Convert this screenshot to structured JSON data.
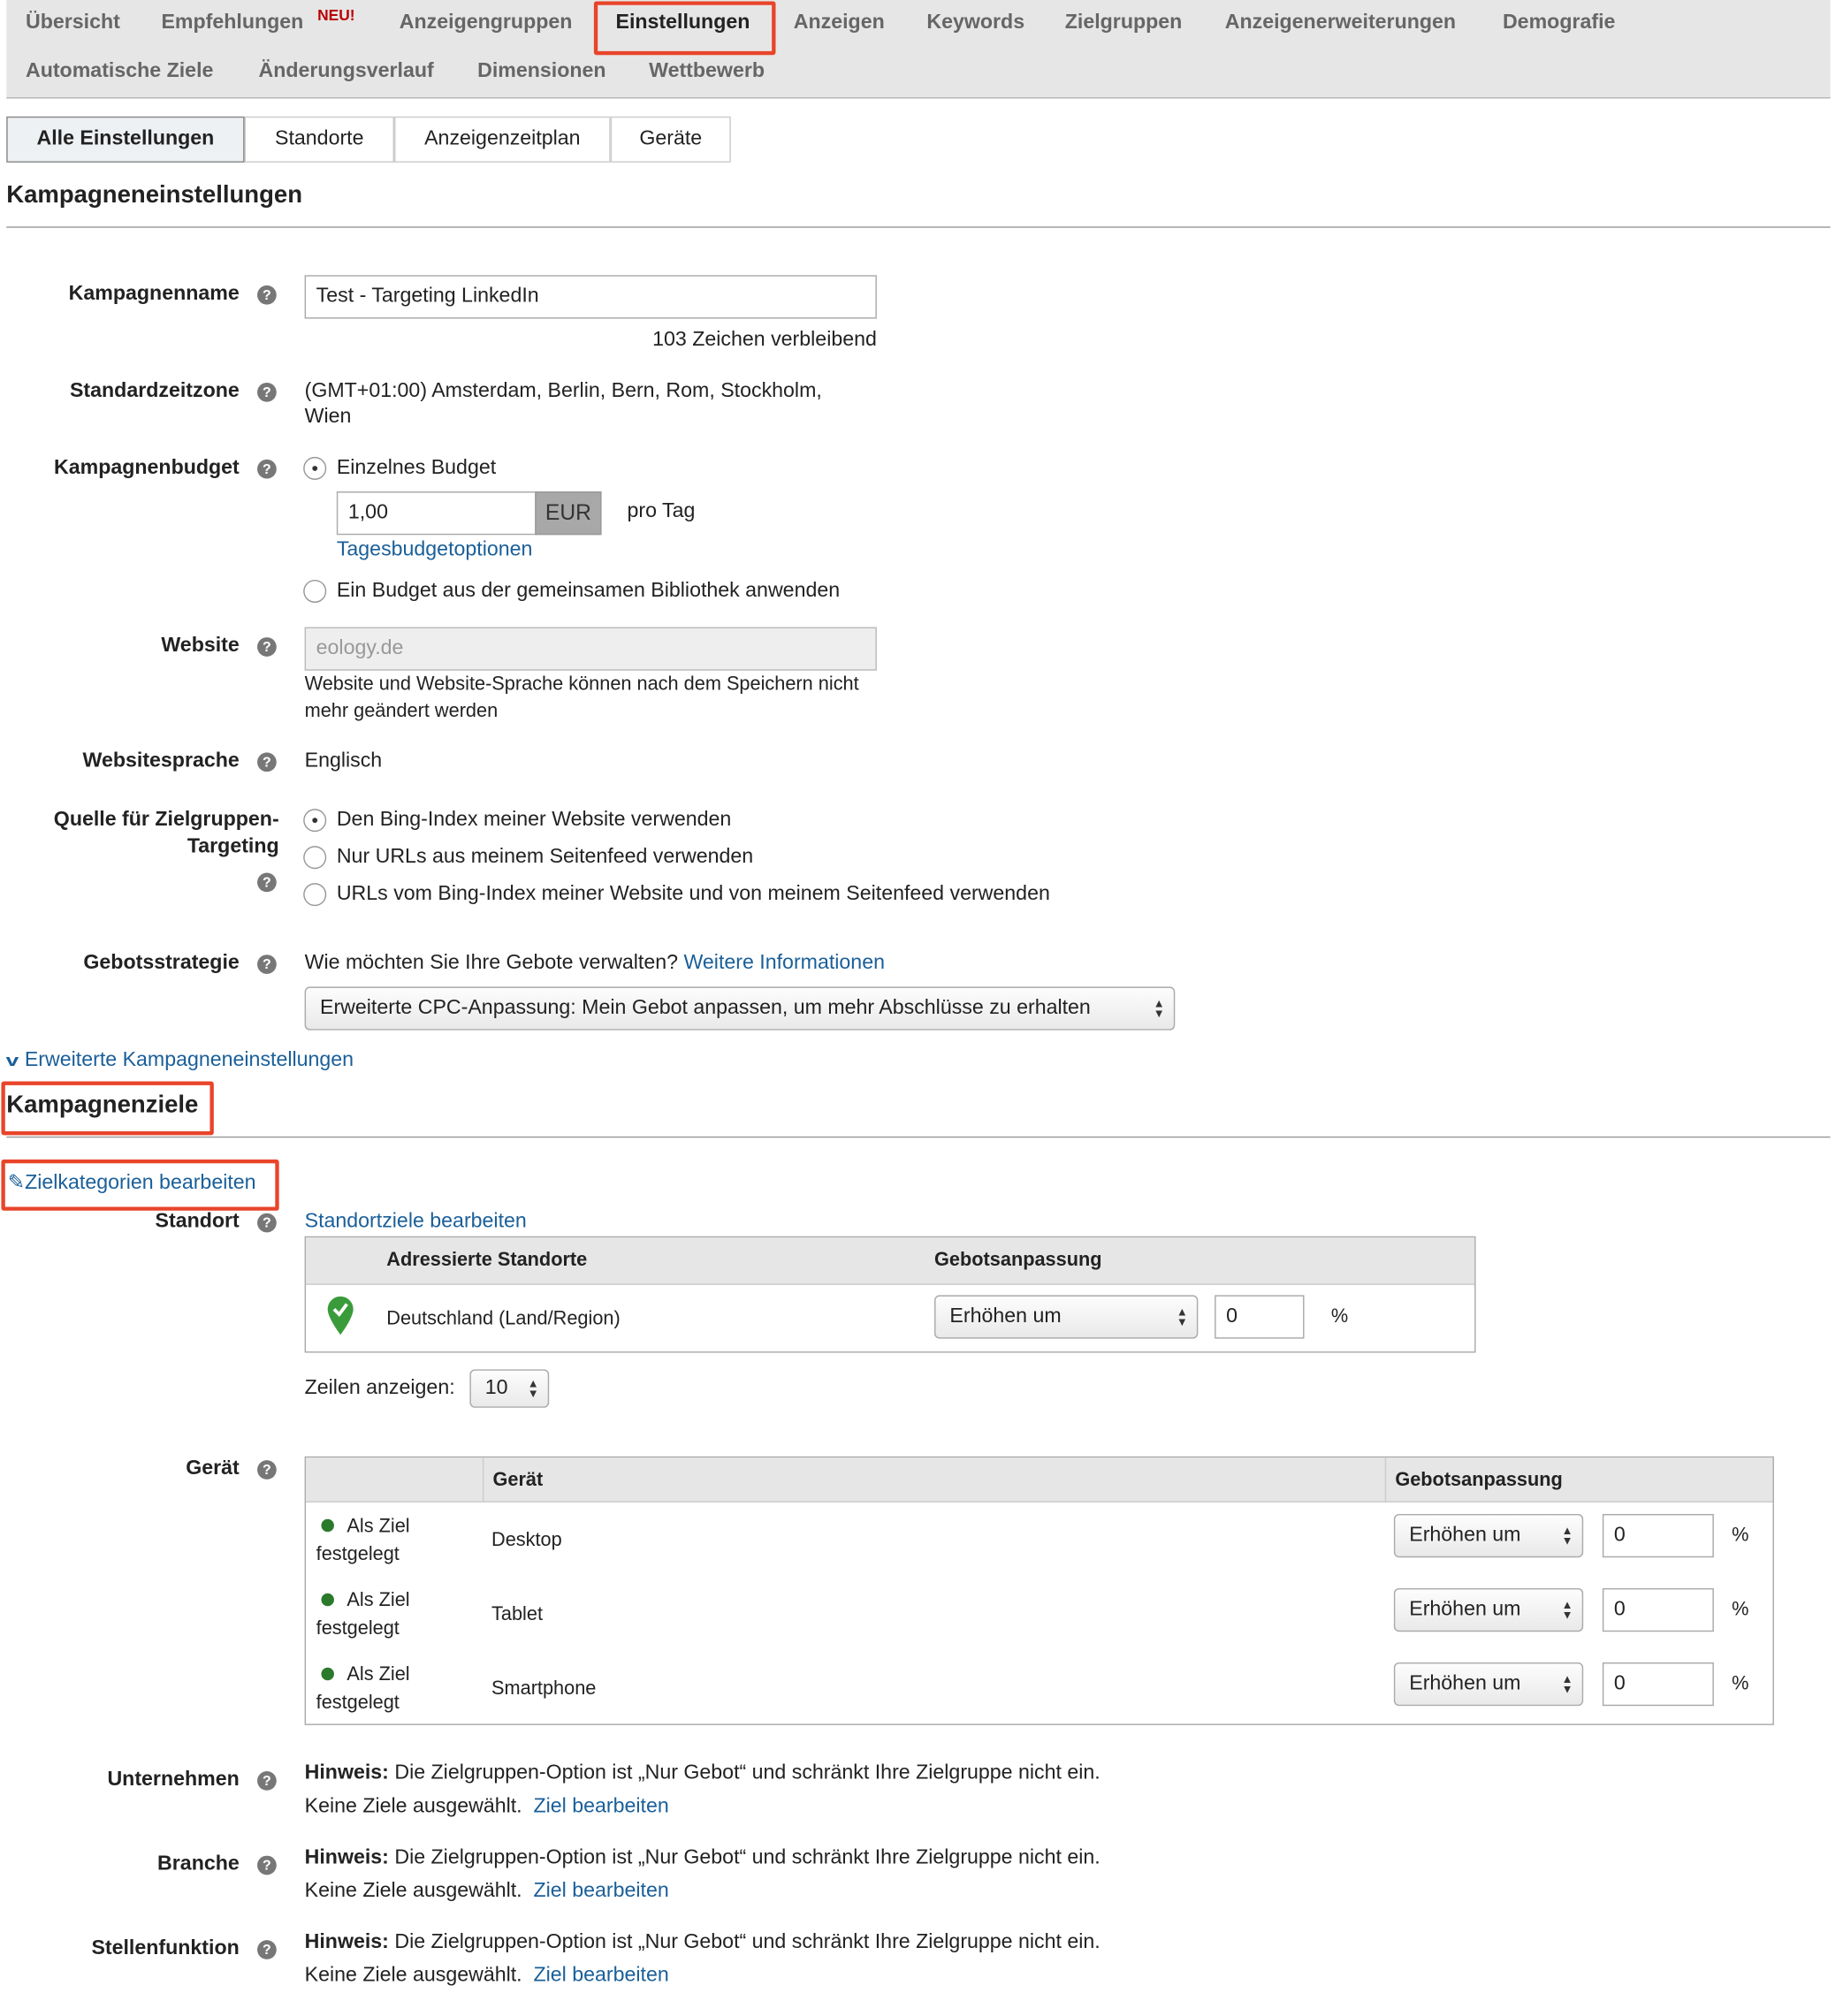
{
  "top_nav": {
    "items": [
      "Übersicht",
      "Empfehlungen",
      "Anzeigengruppen",
      "Einstellungen",
      "Anzeigen",
      "Keywords",
      "Zielgruppen",
      "Anzeigenerweiterungen",
      "Demografie",
      "Automatische Ziele",
      "Änderungsverlauf",
      "Dimensionen",
      "Wettbewerb"
    ],
    "new_badge": "NEU!",
    "active": "Einstellungen"
  },
  "sub_tabs": {
    "items": [
      "Alle Einstellungen",
      "Standorte",
      "Anzeigenzeitplan",
      "Geräte"
    ],
    "active": "Alle Einstellungen"
  },
  "campaign_settings": {
    "heading": "Kampagneneinstellungen",
    "name_label": "Kampagnenname",
    "name_value": "Test - Targeting LinkedIn",
    "chars_remaining": "103 Zeichen verbleibend",
    "timezone_label": "Standardzeitzone",
    "timezone_line1": "(GMT+01:00) Amsterdam, Berlin, Bern, Rom, Stockholm,",
    "timezone_line2": "Wien",
    "budget_label": "Kampagnenbudget",
    "budget_option_single": "Einzelnes Budget",
    "budget_amount": "1,00",
    "budget_currency": "EUR",
    "budget_period": "pro Tag",
    "daily_budget_options_link": "Tagesbudgetoptionen",
    "budget_option_shared": "Ein Budget aus der gemeinsamen Bibliothek anwenden",
    "website_label": "Website",
    "website_value": "eology.de",
    "website_note_line1": "Website und Website-Sprache können nach dem Speichern nicht",
    "website_note_line2": "mehr geändert werden",
    "language_label": "Websitesprache",
    "language_value": "Englisch",
    "targeting_source_label_line1": "Quelle für Zielgruppen-",
    "targeting_source_label_line2": "Targeting",
    "targeting_source_options": [
      "Den Bing-Index meiner Website verwenden",
      "Nur URLs aus meinem Seitenfeed verwenden",
      "URLs vom Bing-Index meiner Website und von meinem Seitenfeed verwenden"
    ],
    "bid_strategy_label": "Gebotsstrategie",
    "bid_strategy_question": "Wie möchten Sie Ihre Gebote verwalten?",
    "bid_strategy_more_link": "Weitere Informationen",
    "bid_strategy_value": "Erweiterte CPC-Anpassung: Mein Gebot anpassen, um mehr Abschlüsse zu erhalten",
    "advanced_link": "Erweiterte Kampagneneinstellungen"
  },
  "campaign_targets": {
    "heading": "Kampagnenziele",
    "edit_categories_link": "Zielkategorien bearbeiten",
    "location_label": "Standort",
    "edit_location_link": "Standortziele bearbeiten",
    "location_table": {
      "headers": [
        "Adressierte Standorte",
        "Gebotsanpassung"
      ],
      "rows": [
        {
          "location": "Deutschland (Land/Region)",
          "adjust": "Erhöhen um",
          "value": "0",
          "unit": "%"
        }
      ]
    },
    "rows_label": "Zeilen anzeigen:",
    "rows_value": "10",
    "device_label": "Gerät",
    "device_table": {
      "headers": [
        "",
        "Gerät",
        "Gebotsanpassung"
      ],
      "rows": [
        {
          "status_line1": "Als Ziel",
          "status_line2": "festgelegt",
          "device": "Desktop",
          "adjust": "Erhöhen um",
          "value": "0",
          "unit": "%"
        },
        {
          "status_line1": "Als Ziel",
          "status_line2": "festgelegt",
          "device": "Tablet",
          "adjust": "Erhöhen um",
          "value": "0",
          "unit": "%"
        },
        {
          "status_line1": "Als Ziel",
          "status_line2": "festgelegt",
          "device": "Smartphone",
          "adjust": "Erhöhen um",
          "value": "0",
          "unit": "%"
        }
      ]
    },
    "notes": [
      {
        "label": "Unternehmen",
        "hint_bold": "Hinweis:",
        "hint_text": " Die Zielgruppen-Option ist „Nur Gebot“ und schränkt Ihre Zielgruppe nicht ein.",
        "none": "Keine Ziele ausgewählt.",
        "edit_link": "Ziel bearbeiten"
      },
      {
        "label": "Branche",
        "hint_bold": "Hinweis:",
        "hint_text": " Die Zielgruppen-Option ist „Nur Gebot“ und schränkt Ihre Zielgruppe nicht ein.",
        "none": "Keine Ziele ausgewählt.",
        "edit_link": "Ziel bearbeiten"
      },
      {
        "label": "Stellenfunktion",
        "hint_bold": "Hinweis:",
        "hint_text": " Die Zielgruppen-Option ist „Nur Gebot“ und schränkt Ihre Zielgruppe nicht ein.",
        "none": "Keine Ziele ausgewählt.",
        "edit_link": "Ziel bearbeiten"
      }
    ]
  },
  "colors": {
    "link": "#1a5f99",
    "highlight_border": "#e8442a",
    "target_green": "#2b7a2b"
  }
}
